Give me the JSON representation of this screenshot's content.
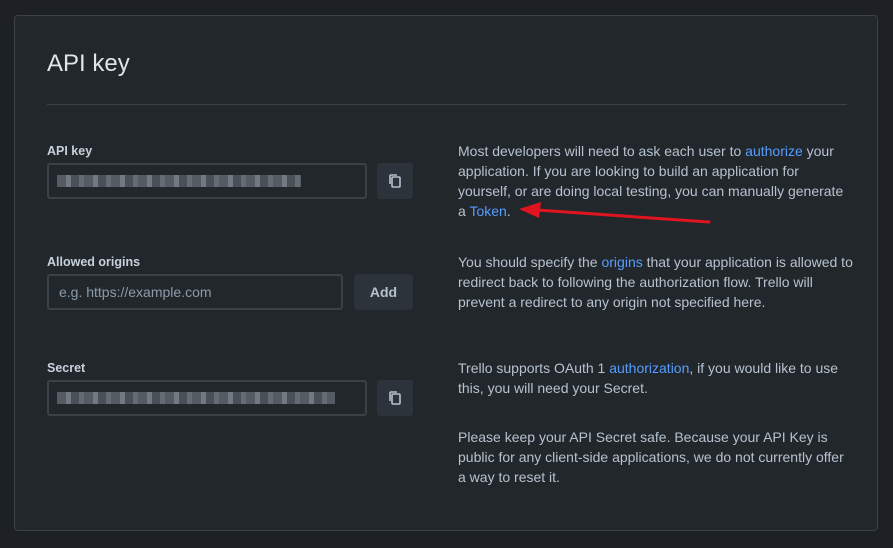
{
  "page": {
    "title": "API key"
  },
  "api_key": {
    "label": "API key",
    "copy_icon": "copy-icon"
  },
  "origins": {
    "label": "Allowed origins",
    "placeholder": "e.g. https://example.com",
    "value": "",
    "add_label": "Add"
  },
  "secret": {
    "label": "Secret",
    "copy_icon": "copy-icon"
  },
  "info": {
    "p1": {
      "t1": "Most developers will need to ask each user to ",
      "link1": "authorize",
      "t2": " your application. If you are looking to build an application for yourself, or are doing local testing, you can manually generate a ",
      "link2": "Token",
      "t3": "."
    },
    "p2": {
      "t1": "You should specify the ",
      "link1": "origins",
      "t2": " that your application is allowed to redirect back to following the authorization flow. Trello will prevent a redirect to any origin not specified here."
    },
    "p3": {
      "t1": "Trello supports OAuth 1 ",
      "link1": "authorization",
      "t2": ", if you would like to use this, you will need your Secret."
    },
    "p4": {
      "t1": "Please keep your API Secret safe. Because your API Key is public for any client-side applications, we do not currently offer a way to reset it."
    }
  },
  "colors": {
    "link": "#579dff",
    "annotation_arrow": "#e0141e"
  }
}
